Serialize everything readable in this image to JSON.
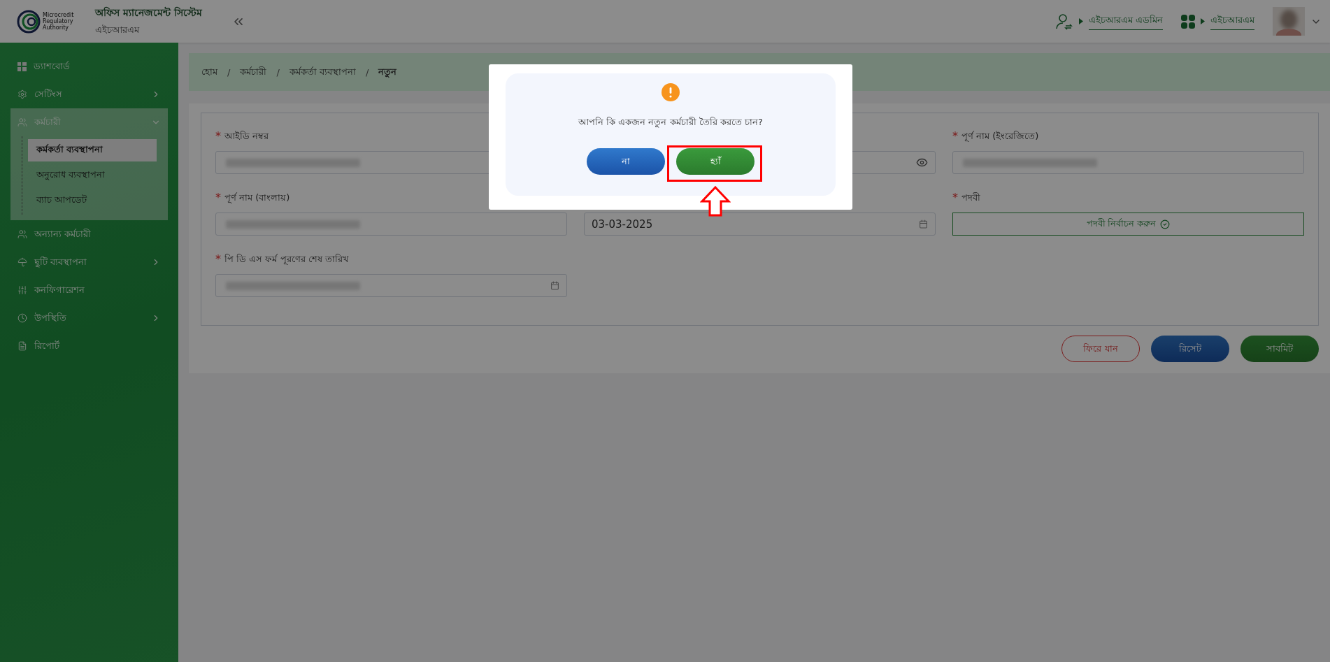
{
  "header": {
    "logo_text": "Microcredit Regulatory Authority",
    "title": "অফিস ম্যানেজমেন্ট সিস্টেম",
    "subtitle": "এইচআরএম",
    "role_link": "এইচআরএম এডমিন",
    "module_link": "এইচআরএম"
  },
  "sidebar": {
    "items": [
      {
        "label": "ড্যাশবোর্ড"
      },
      {
        "label": "সেটিংস",
        "expanded": false
      },
      {
        "label": "কর্মচারী",
        "expanded": true,
        "children": [
          {
            "label": "কর্মকর্তা ব্যবস্থাপনা",
            "selected": true
          },
          {
            "label": "অনুরোধ ব্যবস্থাপনা",
            "selected": false
          },
          {
            "label": "ব্যাচ আপডেট",
            "selected": false
          }
        ]
      },
      {
        "label": "অন্যান্য কর্মচারী"
      },
      {
        "label": "ছুটি ব্যবস্থাপনা",
        "expanded": false
      },
      {
        "label": "কনফিগারেশন"
      },
      {
        "label": "উপস্থিতি",
        "expanded": false
      },
      {
        "label": "রিপোর্ট"
      }
    ]
  },
  "breadcrumb": {
    "items": [
      "হোম",
      "কর্মচারী",
      "কর্মকর্তা ব্যবস্থাপনা",
      "নতুন"
    ],
    "separators": [
      "/",
      "/",
      "/"
    ]
  },
  "form": {
    "fields": [
      {
        "kind": "text",
        "required_mark": "*",
        "label": "আইডি নম্বর",
        "value_hidden": true
      },
      {
        "kind": "password"
      },
      {
        "kind": "text",
        "required_mark": "*",
        "label": "পূর্ণ নাম (ইংরেজিতে)",
        "value_hidden": true
      },
      {
        "kind": "text",
        "required_mark": "*",
        "label": "পূর্ণ নাম (বাংলায়)",
        "value_hidden": true
      },
      {
        "kind": "date",
        "value": "03-03-2025",
        "value_hidden": false
      },
      {
        "kind": "select_button",
        "required_mark": "*",
        "label": "পদবী",
        "button": "পদবী নির্বাচন করুন"
      },
      {
        "kind": "date",
        "required_mark": "*",
        "label": "পি ডি এস ফর্ম পূরণের শেষ তারিখ",
        "value_hidden": true
      }
    ]
  },
  "actions": [
    {
      "label": "ফিরে যান",
      "kind": "back"
    },
    {
      "label": "রিসেট",
      "kind": "reset"
    },
    {
      "label": "সাবমিট",
      "kind": "submit"
    }
  ],
  "dialog": {
    "message": "আপনি কি একজন নতুন কর্মচারী তৈরি করতে চান?",
    "buttons": [
      {
        "label": "না",
        "kind": "cancel",
        "highlighted": false
      },
      {
        "label": "হ্যাঁ",
        "kind": "confirm",
        "highlighted": true
      }
    ]
  }
}
